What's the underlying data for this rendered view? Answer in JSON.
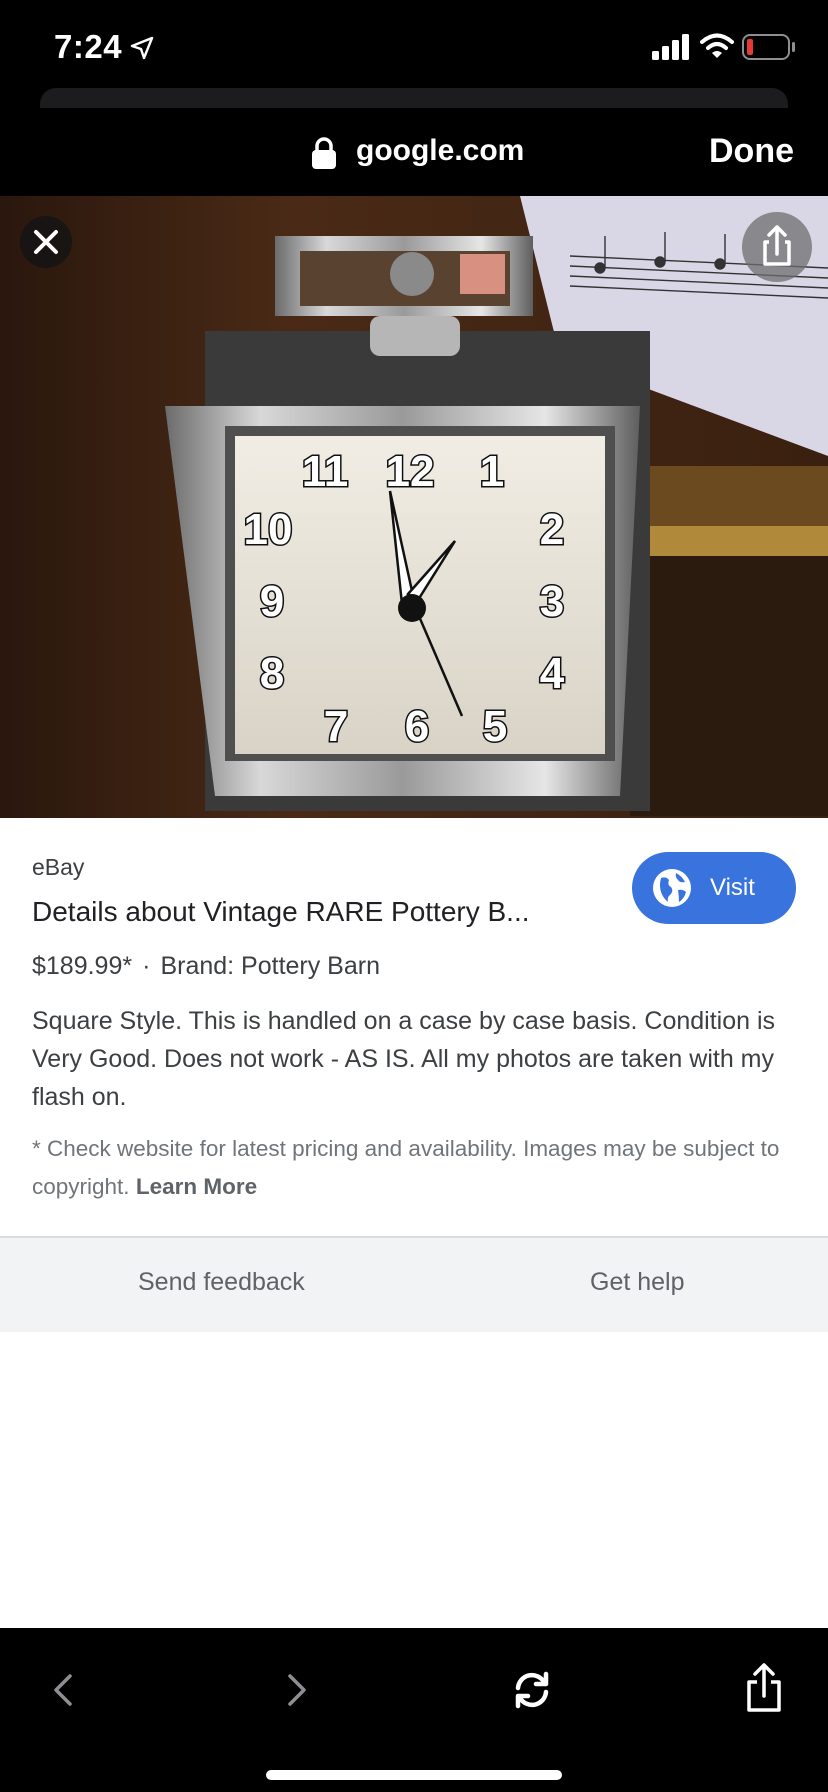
{
  "status_bar": {
    "time": "7:24"
  },
  "browser": {
    "url": "google.com",
    "done_label": "Done"
  },
  "result": {
    "source": "eBay",
    "title": "Details about Vintage RARE Pottery B...",
    "visit_label": "Visit",
    "price": "$189.99*",
    "separator": "·",
    "brand": "Brand: Pottery Barn",
    "description": "Square Style. This is handled on a case by case basis. Condition is Very Good. Does not work - AS IS. All my photos are taken with my flash on.",
    "disclaimer": "* Check website for latest pricing and availability. Images may be subject to copyright.",
    "learn_more": "Learn More"
  },
  "clock_numerals": [
    "11",
    "12",
    "1",
    "2",
    "3",
    "4",
    "5",
    "6",
    "7",
    "8",
    "9",
    "10"
  ],
  "footer": {
    "send_feedback": "Send feedback",
    "get_help": "Get help"
  },
  "toolbar": {
    "icons": [
      "back-icon",
      "forward-icon",
      "reload-icon",
      "share-icon"
    ]
  },
  "colors": {
    "visit_button": "#3873de",
    "battery_low": "#e53935",
    "footer_bg": "#f1f3f4"
  }
}
